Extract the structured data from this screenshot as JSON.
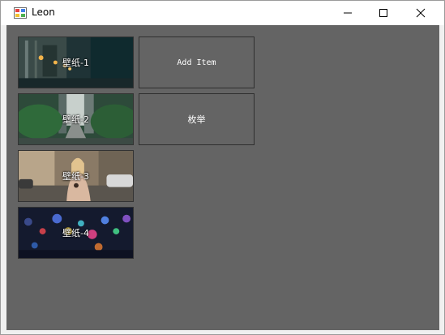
{
  "window": {
    "title": "Leon",
    "minimize_label": "minimize",
    "maximize_label": "maximize",
    "close_label": "close"
  },
  "tiles": [
    {
      "label": "壁纸-1",
      "icon": "wallpaper-city-night-image"
    },
    {
      "label": "壁纸-2",
      "icon": "wallpaper-street-trees-image"
    },
    {
      "label": "壁纸-3",
      "icon": "wallpaper-woman-street-image"
    },
    {
      "label": "壁纸-4",
      "icon": "wallpaper-bokeh-lights-image"
    }
  ],
  "buttons": {
    "add_item": "Add Item",
    "enumerate": "枚举"
  },
  "colors": {
    "client_background": "#646464",
    "titlebar_background": "#ffffff",
    "tile_border": "#333333"
  }
}
